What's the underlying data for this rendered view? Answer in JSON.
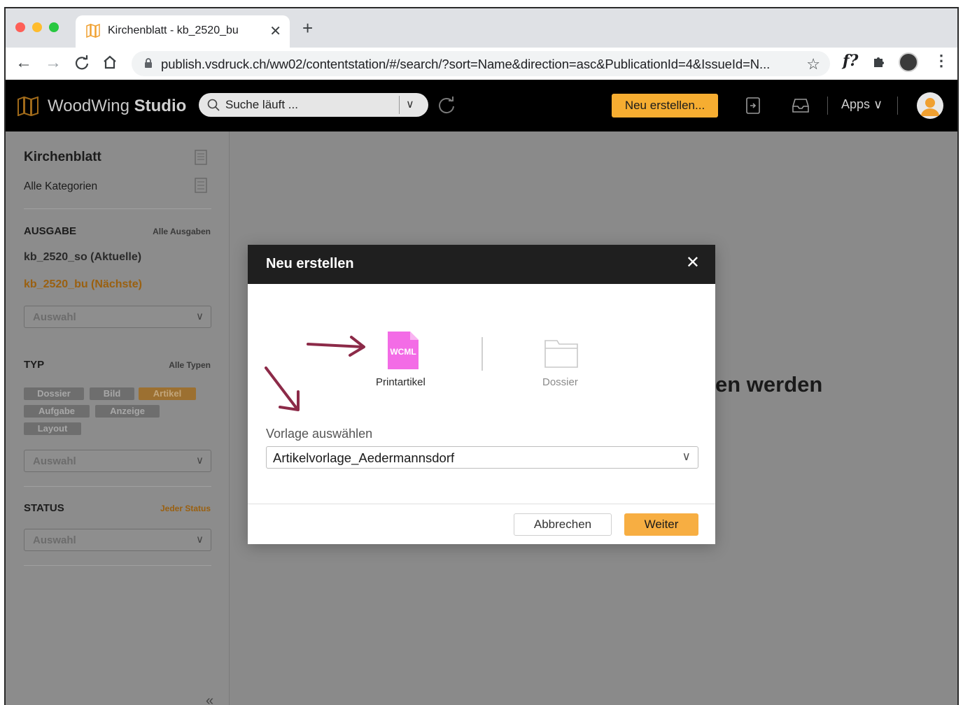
{
  "browser": {
    "tab_title": "Kirchenblatt - kb_2520_bu",
    "tab_close": "✕",
    "new_tab": "+",
    "url": "publish.vsdruck.ch/ww02/contentstation/#/search/?sort=Name&direction=asc&PublicationId=4&IssueId=N...",
    "ext_f": "f?"
  },
  "app": {
    "brand_light": "WoodWing",
    "brand_bold": "Studio",
    "search_text": "Suche läuft ...",
    "new_button": "Neu erstellen...",
    "apps_label": "Apps",
    "accent_color": "#f6ad31"
  },
  "sidebar": {
    "title": "Kirchenblatt",
    "subtitle": "Alle Kategorien",
    "ausgabe": {
      "heading": "AUSGABE",
      "all_link": "Alle Ausgaben",
      "items": [
        "kb_2520_so (Aktuelle)",
        "kb_2520_bu (Nächste)"
      ],
      "select_placeholder": "Auswahl"
    },
    "typ": {
      "heading": "TYP",
      "all_link": "Alle Typen",
      "chips": [
        "Dossier",
        "Bild",
        "Artikel",
        "Aufgabe",
        "Anzeige",
        "Layout"
      ],
      "select_placeholder": "Auswahl"
    },
    "status": {
      "heading": "STATUS",
      "all_link": "Jeder Status",
      "select_placeholder": "Auswahl"
    },
    "collapse": "«"
  },
  "background_text": "en werden",
  "modal": {
    "title": "Neu erstellen",
    "close": "✕",
    "options": [
      {
        "label": "Printartikel",
        "icon_text": "WCML"
      },
      {
        "label": "Dossier"
      }
    ],
    "template_label": "Vorlage auswählen",
    "template_value": "Artikelvorlage_Aedermannsdorf",
    "cancel": "Abbrechen",
    "next": "Weiter"
  }
}
